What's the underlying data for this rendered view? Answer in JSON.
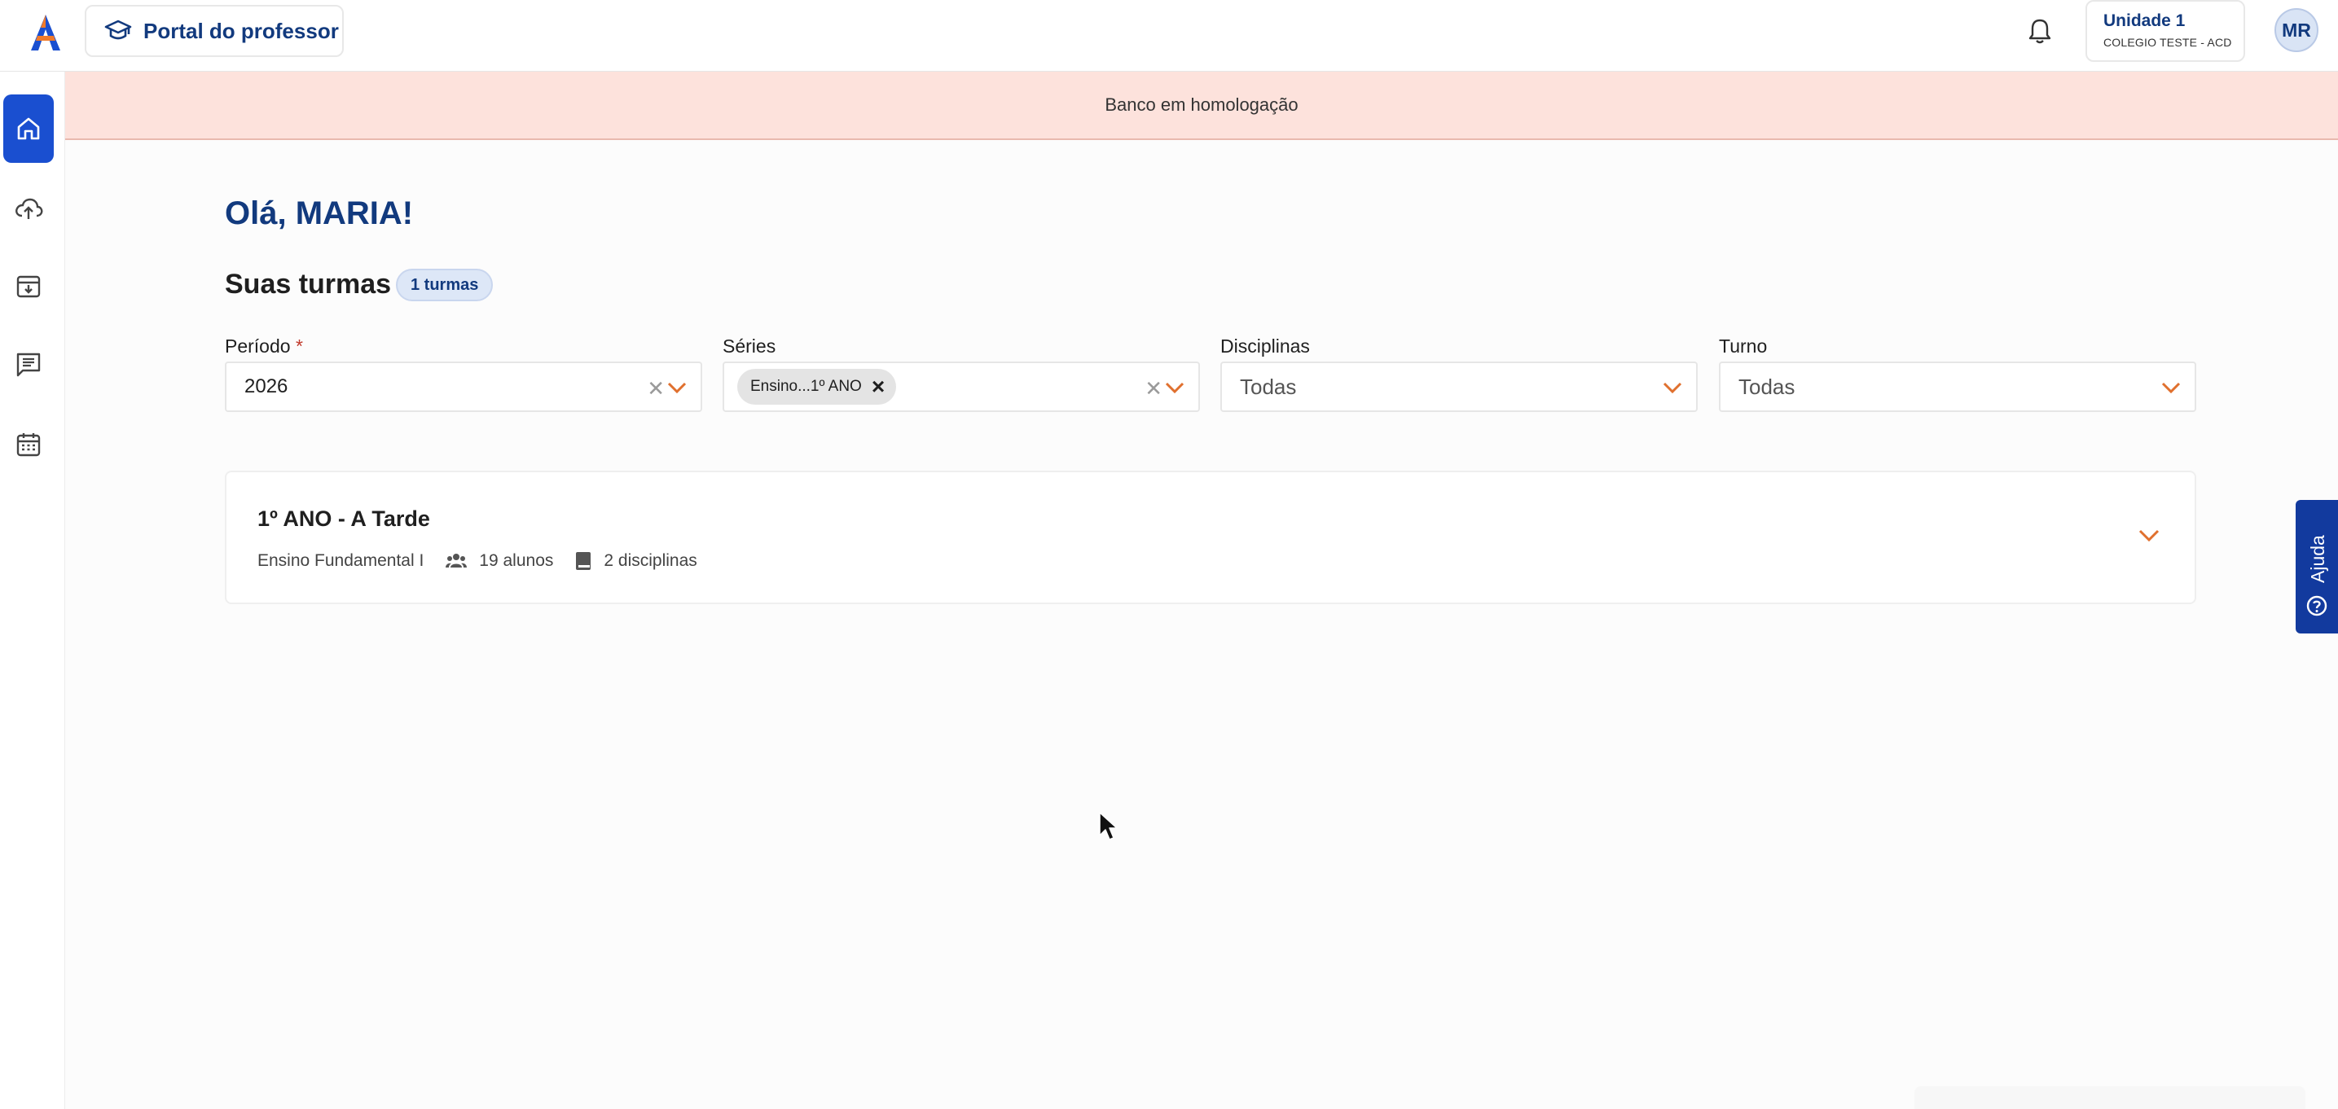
{
  "header": {
    "portal_label": "Portal do professor",
    "unit_name": "Unidade 1",
    "unit_school": "COLEGIO TESTE - ACD",
    "avatar_initials": "MR"
  },
  "sidebar": {
    "items": [
      {
        "icon": "home-icon",
        "active": true
      },
      {
        "icon": "cloud-upload-icon",
        "active": false
      },
      {
        "icon": "archive-download-icon",
        "active": false
      },
      {
        "icon": "message-list-icon",
        "active": false
      },
      {
        "icon": "calendar-icon",
        "active": false
      }
    ]
  },
  "banner": {
    "text": "Banco em homologação"
  },
  "main": {
    "greeting": "Olá, MARIA!",
    "section_title": "Suas turmas",
    "count_badge": "1 turmas"
  },
  "filters": {
    "periodo": {
      "label": "Período",
      "required_mark": "*",
      "value": "2026"
    },
    "series": {
      "label": "Séries",
      "chip": "Ensino...1º ANO"
    },
    "disciplinas": {
      "label": "Disciplinas",
      "value": "Todas"
    },
    "turno": {
      "label": "Turno",
      "value": "Todas"
    }
  },
  "classes": [
    {
      "title": "1º ANO - A Tarde",
      "level": "Ensino Fundamental I",
      "students": "19 alunos",
      "subjects": "2 disciplinas"
    }
  ],
  "help": {
    "label": "Ajuda"
  },
  "colors": {
    "brand_blue": "#123a7e",
    "active_blue": "#1a4fd0",
    "accent_orange": "#e0702e",
    "banner_bg": "#fde2dc"
  }
}
